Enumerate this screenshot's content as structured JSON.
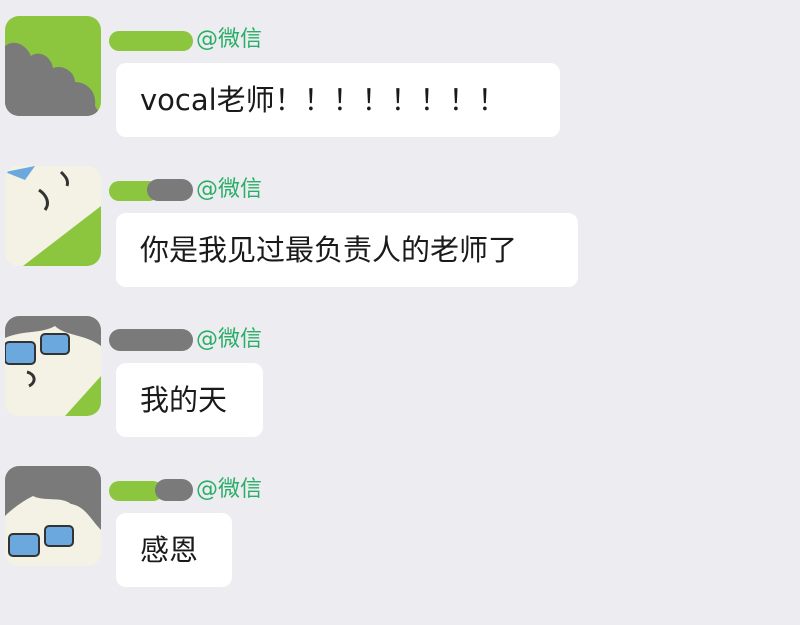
{
  "messages": [
    {
      "sender_suffix": "@微信",
      "text": "vocal老师！！！！！！！！",
      "avatar": "cartoon-avatar-icon"
    },
    {
      "sender_suffix": "@微信",
      "text": "你是我见过最负责人的老师了",
      "avatar": "cartoon-avatar-icon"
    },
    {
      "sender_suffix": "@微信",
      "text": "我的天",
      "avatar": "cartoon-avatar-icon"
    },
    {
      "sender_suffix": "@微信",
      "text": "感恩",
      "avatar": "cartoon-avatar-icon"
    }
  ],
  "colors": {
    "background": "#ededf1",
    "bubble": "#ffffff",
    "sender_suffix": "#2aae67",
    "avatar_green": "#8cc63f",
    "avatar_gray": "#7a7a7a",
    "glasses_blue": "#6aa8de"
  }
}
